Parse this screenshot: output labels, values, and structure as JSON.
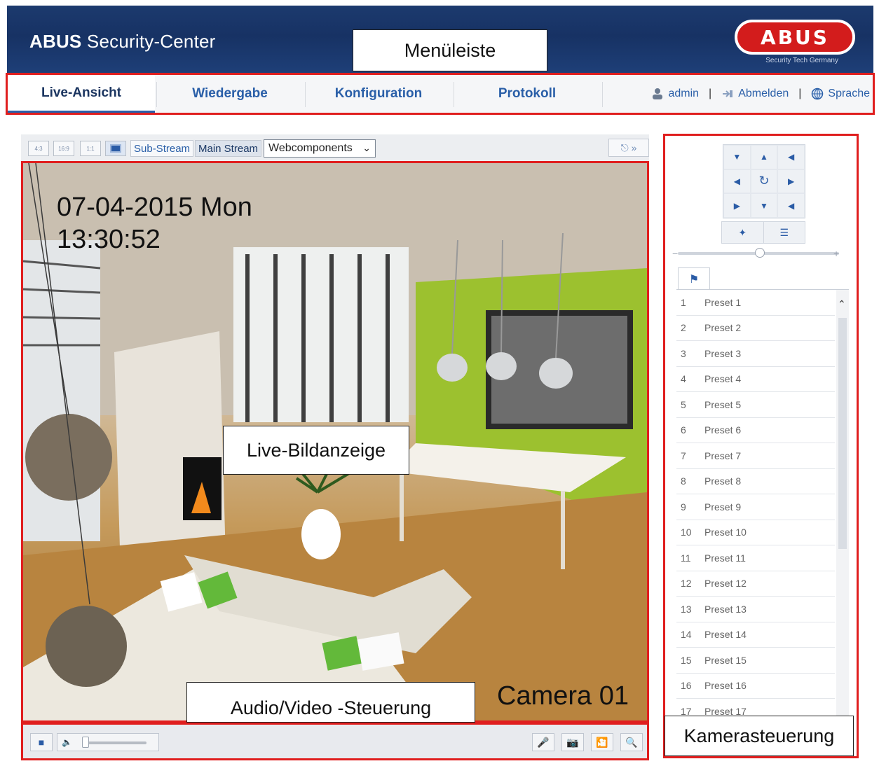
{
  "header": {
    "brand_bold": "ABUS",
    "brand_rest": "Security-Center",
    "logo_text": "ABUS",
    "logo_sub": "Security Tech Germany"
  },
  "annotations": {
    "menu": "Menüleiste",
    "live": "Live-Bildanzeige",
    "av": "Audio/Video -Steuerung",
    "camera": "Kamerasteuerung"
  },
  "nav": {
    "tabs": [
      {
        "label": "Live-Ansicht",
        "active": true
      },
      {
        "label": "Wiedergabe",
        "active": false
      },
      {
        "label": "Konfiguration",
        "active": false
      },
      {
        "label": "Protokoll",
        "active": false
      }
    ],
    "user": "admin",
    "logout": "Abmelden",
    "language": "Sprache"
  },
  "toolbar": {
    "ratio_buttons": [
      "4:3",
      "16:9",
      "1:1"
    ],
    "sub_stream": "Sub-Stream",
    "main_stream": "Main Stream",
    "plugin_select": "Webcomponents"
  },
  "video": {
    "date": "07-04-2015  Mon",
    "time": "13:30:52",
    "camera": "Camera 01"
  },
  "presets": [
    {
      "num": "1",
      "name": "Preset 1"
    },
    {
      "num": "2",
      "name": "Preset 2"
    },
    {
      "num": "3",
      "name": "Preset 3"
    },
    {
      "num": "4",
      "name": "Preset 4"
    },
    {
      "num": "5",
      "name": "Preset 5"
    },
    {
      "num": "6",
      "name": "Preset 6"
    },
    {
      "num": "7",
      "name": "Preset 7"
    },
    {
      "num": "8",
      "name": "Preset 8"
    },
    {
      "num": "9",
      "name": "Preset 9"
    },
    {
      "num": "10",
      "name": "Preset 10"
    },
    {
      "num": "11",
      "name": "Preset 11"
    },
    {
      "num": "12",
      "name": "Preset 12"
    },
    {
      "num": "13",
      "name": "Preset 13"
    },
    {
      "num": "14",
      "name": "Preset 14"
    },
    {
      "num": "15",
      "name": "Preset 15"
    },
    {
      "num": "16",
      "name": "Preset 16"
    },
    {
      "num": "17",
      "name": "Preset 17"
    }
  ],
  "colors": {
    "accent": "#2a5fa8",
    "highlight_frame": "#e01e1e",
    "header_bg": "#173264"
  }
}
